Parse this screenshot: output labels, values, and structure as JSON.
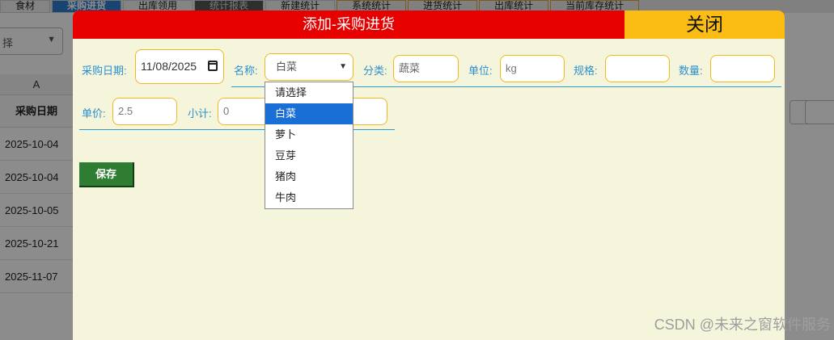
{
  "background": {
    "tabs": [
      {
        "label": "食材"
      },
      {
        "label": "采购进货"
      },
      {
        "label": "出库领用"
      },
      {
        "label": "统计报表"
      },
      {
        "label": "新建统计"
      },
      {
        "label": "系统统计"
      },
      {
        "label": "进货统计"
      },
      {
        "label": "出库统计"
      },
      {
        "label": "当前库存统计"
      }
    ],
    "filter_select": "择",
    "column_letter": "A",
    "column_header": "采购日期",
    "dates": [
      "2025-10-04",
      "2025-10-04",
      "2025-10-05",
      "2025-10-21",
      "2025-11-07"
    ]
  },
  "modal": {
    "title": "添加-采购进货",
    "close_label": "关闭",
    "fields": {
      "date_label": "采购日期:",
      "date_value": "11/08/2025",
      "name_label": "名称:",
      "name_value": "白菜",
      "category_label": "分类:",
      "category_value": "蔬菜",
      "unit_label": "单位:",
      "unit_value": "kg",
      "spec_label": "规格:",
      "spec_value": "",
      "qty_label": "数量:",
      "qty_value": "",
      "price_label": "单价:",
      "price_value": "2.5",
      "subtotal_label": "小计:",
      "subtotal_value": "0"
    },
    "dropdown_options": [
      {
        "label": "请选择"
      },
      {
        "label": "白菜",
        "selected": true
      },
      {
        "label": "萝卜"
      },
      {
        "label": "豆芽"
      },
      {
        "label": "猪肉"
      },
      {
        "label": "牛肉"
      }
    ],
    "save_label": "保存"
  },
  "watermark": "CSDN @未来之窗软件服务",
  "colors": {
    "header_red": "#e60000",
    "close_yellow": "#fbbd14",
    "modal_bg": "#f5f5dc",
    "label_blue": "#2b8fd0",
    "save_green": "#2e7d32",
    "option_highlight": "#1a6fd6"
  }
}
